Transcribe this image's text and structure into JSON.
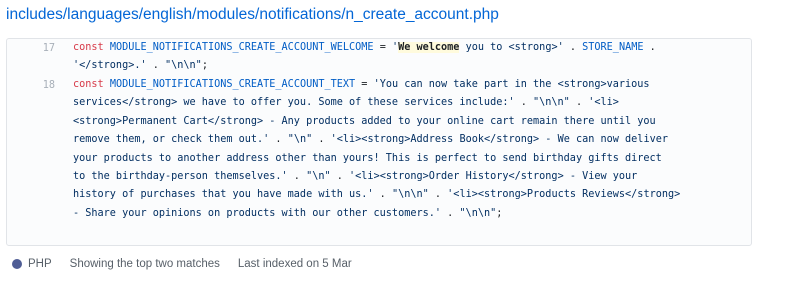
{
  "result": {
    "file_path": "includes/languages/english/modules/notifications/n_create_account.php",
    "lines": [
      {
        "number": "17",
        "code": "const MODULE_NOTIFICATIONS_CREATE_ACCOUNT_WELCOME = 'We welcome you to <strong>' . STORE_NAME .\n'</strong>.' . \"\\n\\n\";"
      },
      {
        "number": "18",
        "code": "const MODULE_NOTIFICATIONS_CREATE_ACCOUNT_TEXT = 'You can now take part in the <strong>various\nservices</strong> we have to offer you. Some of these services include:' . \"\\n\\n\" . '<li>\n<strong>Permanent Cart</strong> - Any products added to your online cart remain there until you\nremove them, or check them out.' . \"\\n\" . '<li><strong>Address Book</strong> - We can now deliver\nyour products to another address other than yours! This is perfect to send birthday gifts direct\nto the birthday-person themselves.' . \"\\n\" . '<li><strong>Order History</strong> - View your\nhistory of purchases that you have made with us.' . \"\\n\\n\" . '<li><strong>Products Reviews</strong>\n- Share your opinions on products with our other customers.' . \"\\n\\n\";"
      }
    ],
    "highlight_term": "We welcome"
  },
  "footer": {
    "language": "PHP",
    "language_color": "#4f5d95",
    "matches_text": "Showing the top two matches",
    "indexed_text": "Last indexed on 5 Mar"
  }
}
